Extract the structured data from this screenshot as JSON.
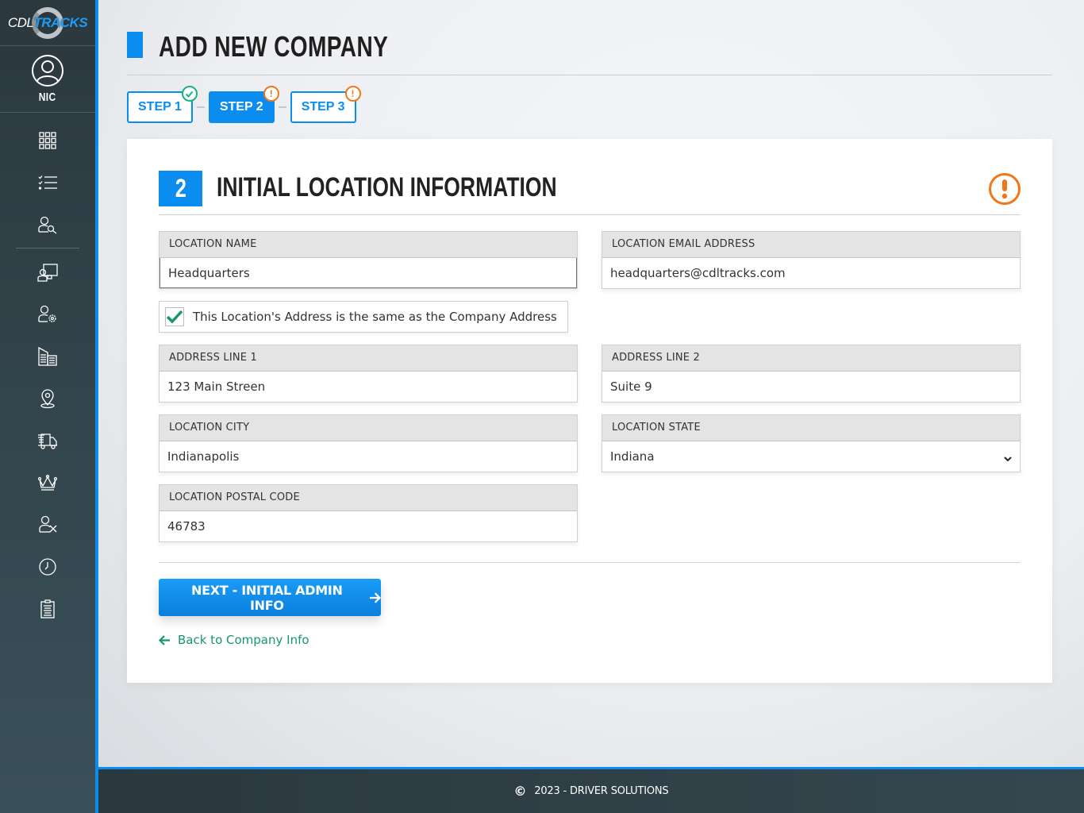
{
  "app": {
    "logo_left": "CDL",
    "logo_right": "TRACKS",
    "brand_color": "#0b8df0",
    "warning_color": "#f07818",
    "success_color": "#19b37c"
  },
  "sidebar": {
    "user_name": "NIC",
    "items": [
      {
        "icon": "dashboard-grid-icon"
      },
      {
        "icon": "checklist-icon"
      },
      {
        "icon": "user-search-icon"
      },
      {
        "icon": "user-presentation-icon"
      },
      {
        "icon": "user-settings-icon"
      },
      {
        "icon": "buildings-icon"
      },
      {
        "icon": "location-pin-icon"
      },
      {
        "icon": "truck-icon"
      },
      {
        "icon": "crown-icon"
      },
      {
        "icon": "user-remove-icon"
      },
      {
        "icon": "clock-icon"
      },
      {
        "icon": "clipboard-icon"
      }
    ]
  },
  "page": {
    "title": "ADD NEW COMPANY",
    "steps": [
      {
        "label": "STEP 1",
        "status": "complete",
        "badge": "✓"
      },
      {
        "label": "STEP 2",
        "status": "warning",
        "badge": "!",
        "active": true
      },
      {
        "label": "STEP 3",
        "status": "warning",
        "badge": "!"
      }
    ]
  },
  "section": {
    "number": "2",
    "title": "INITIAL LOCATION INFORMATION",
    "status_icon": "warning-icon"
  },
  "form": {
    "location_name": {
      "label": "LOCATION NAME",
      "value": "Headquarters"
    },
    "location_email": {
      "label": "LOCATION EMAIL ADDRESS",
      "value": "headquarters@cdltracks.com"
    },
    "same_address": {
      "label": "This Location's Address is the same as the Company Address",
      "checked": true
    },
    "address_line_1": {
      "label": "ADDRESS LINE 1",
      "value": "123 Main Streen"
    },
    "address_line_2": {
      "label": "ADDRESS LINE 2",
      "value": "Suite 9"
    },
    "city": {
      "label": "LOCATION CITY",
      "value": "Indianapolis"
    },
    "state": {
      "label": "LOCATION STATE",
      "value": "Indiana"
    },
    "postal_code": {
      "label": "LOCATION POSTAL CODE",
      "value": "46783"
    }
  },
  "actions": {
    "next_label": "NEXT - INITIAL ADMIN INFO",
    "back_label": "Back to Company Info"
  },
  "footer": {
    "text": "2023 - DRIVER SOLUTIONS"
  }
}
